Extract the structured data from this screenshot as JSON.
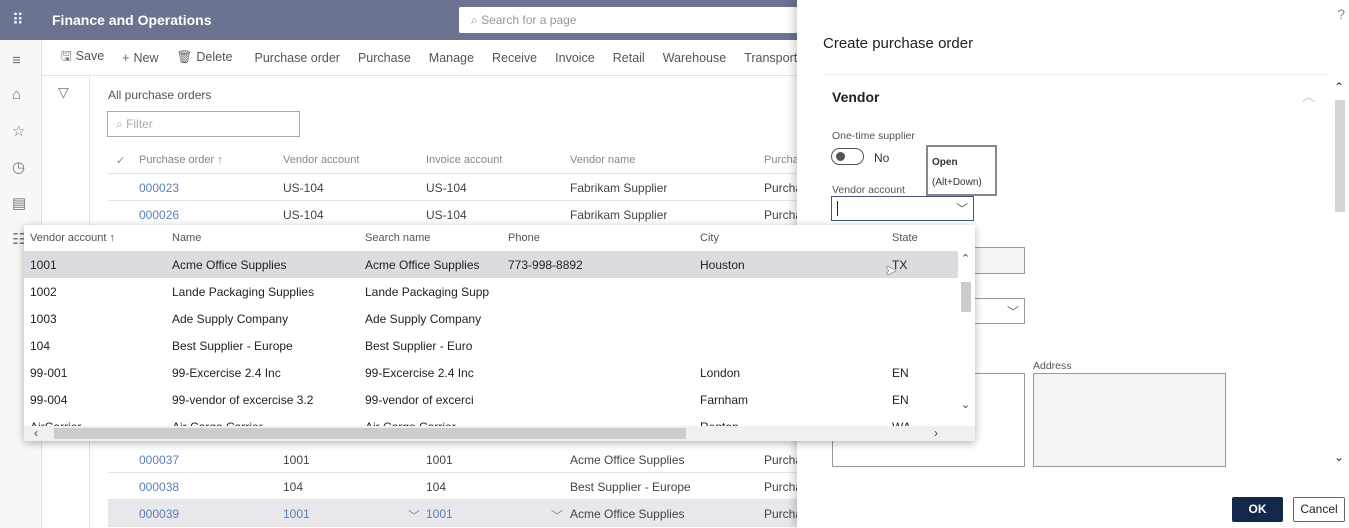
{
  "app": {
    "title": "Finance and Operations",
    "search_placeholder": "Search for a page"
  },
  "nav": {
    "icons": [
      "hamburger-icon",
      "home-icon",
      "star-icon",
      "clock-icon",
      "workspace-icon",
      "list-icon"
    ]
  },
  "toolbar": {
    "save": "Save",
    "new": "New",
    "delete": "Delete",
    "tabs": [
      "Purchase order",
      "Purchase",
      "Manage",
      "Receive",
      "Invoice",
      "Retail",
      "Warehouse",
      "Transporta"
    ]
  },
  "list": {
    "title": "All purchase orders",
    "filter_placeholder": "Filter",
    "columns": [
      "Purchase order ↑",
      "Vendor account",
      "Invoice account",
      "Vendor name",
      "Purcha"
    ],
    "rows_top": [
      [
        "000023",
        "US-104",
        "US-104",
        "Fabrikam Supplier",
        "Purcha"
      ],
      [
        "000026",
        "US-104",
        "US-104",
        "Fabrikam Supplier",
        "Purcha"
      ]
    ],
    "rows_bottom": [
      [
        "000037",
        "1001",
        "1001",
        "Acme Office Supplies",
        "Purcha"
      ],
      [
        "000038",
        "104",
        "104",
        "Best Supplier - Europe",
        "Purcha"
      ],
      [
        "000039",
        "1001",
        "1001",
        "Acme Office Supplies",
        "Purcha"
      ]
    ],
    "selected_row": "000039"
  },
  "lookup": {
    "columns": [
      "Vendor account ↑",
      "Name",
      "Search name",
      "Phone",
      "City",
      "State"
    ],
    "rows": [
      [
        "1001",
        "Acme Office Supplies",
        "Acme Office Supplies",
        "773-998-8892",
        "Houston",
        "TX"
      ],
      [
        "1002",
        "Lande Packaging Supplies",
        "Lande Packaging Supp",
        "",
        "",
        ""
      ],
      [
        "1003",
        "Ade Supply Company",
        "Ade Supply Company",
        "",
        "",
        ""
      ],
      [
        "104",
        "Best Supplier - Europe",
        "Best Supplier - Euro",
        "",
        "",
        ""
      ],
      [
        "99-001",
        "99-Excercise 2.4 Inc",
        "99-Excercise 2.4 Inc",
        "",
        "London",
        "EN"
      ],
      [
        "99-004",
        "99-vendor of excercise 3.2",
        "99-vendor of excerci",
        "",
        "Farnham",
        "EN"
      ],
      [
        "AirCarrier",
        "Air Cargo Carrier",
        "Air Cargo Carrier",
        "",
        "Renton",
        "WA"
      ]
    ],
    "selected_row": "1001"
  },
  "dialog": {
    "help": "?",
    "title": "Create purchase order",
    "section": "Vendor",
    "one_time_label": "One-time supplier",
    "one_time_value": "No",
    "tooltip_line1": "Open",
    "tooltip_line2": "(Alt+Down)",
    "vendor_account_label": "Vendor account",
    "vendor_account_value": "",
    "address_label": "Address",
    "ok": "OK",
    "cancel": "Cancel"
  },
  "colors": {
    "topbar": "#6b7390",
    "link": "#5a7fb8",
    "primary_button": "#13294b"
  }
}
